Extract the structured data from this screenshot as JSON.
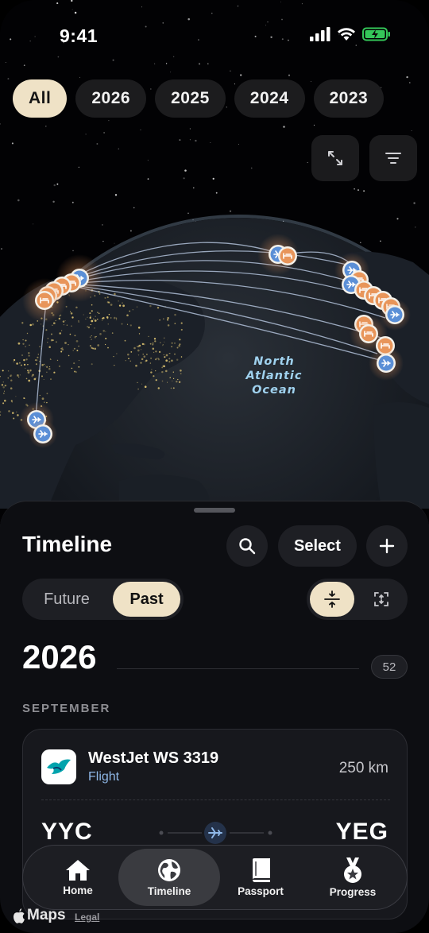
{
  "status": {
    "time": "9:41"
  },
  "year_filter": {
    "options": [
      "All",
      "2026",
      "2025",
      "2024",
      "2023"
    ],
    "selected": "All"
  },
  "map": {
    "ocean_label_lines": [
      "North",
      "Atlantic",
      "Ocean"
    ]
  },
  "sheet": {
    "title": "Timeline",
    "select_label": "Select",
    "segments": {
      "future": "Future",
      "past": "Past",
      "selected": "Past"
    },
    "year": "2026",
    "count": "52",
    "month": "SEPTEMBER",
    "flight": {
      "airline": "WestJet WS 3319",
      "type": "Flight",
      "distance": "250 km",
      "from": "YYC",
      "to": "YEG"
    }
  },
  "tabbar": {
    "items": [
      {
        "label": "Home",
        "icon": "house-icon"
      },
      {
        "label": "Timeline",
        "icon": "globe-icon",
        "active": true
      },
      {
        "label": "Passport",
        "icon": "book-icon"
      },
      {
        "label": "Progress",
        "icon": "medal-icon"
      }
    ]
  },
  "watermark": {
    "maps": "Maps",
    "legal": "Legal"
  },
  "colors": {
    "accent": "#efe2c6",
    "hotel_orange": "#e8955a",
    "flight_blue": "#5b8fd6",
    "background": "#0d0e12"
  }
}
